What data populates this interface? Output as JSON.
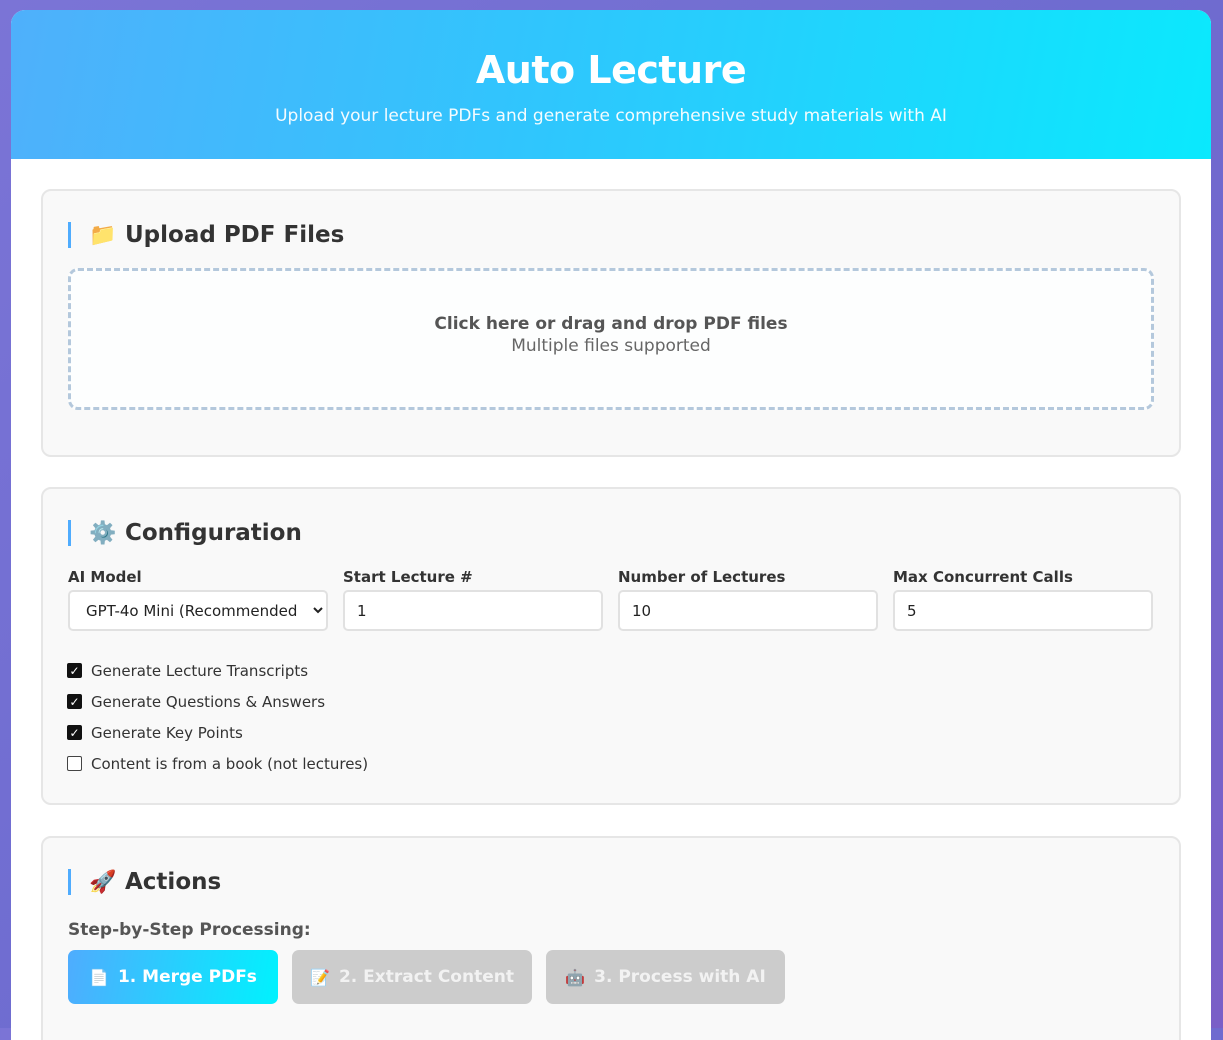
{
  "header": {
    "title": "Auto Lecture",
    "subtitle": "Upload your lecture PDFs and generate comprehensive study materials with AI"
  },
  "upload": {
    "title": "Upload PDF Files",
    "icon": "folder-icon",
    "drop_primary": "Click here or drag and drop PDF files",
    "drop_secondary": "Multiple files supported"
  },
  "config": {
    "title": "Configuration",
    "icon": "gear-icon",
    "ai_model_label": "AI Model",
    "ai_model_value": "GPT-4o Mini (Recommended)",
    "start_lecture_label": "Start Lecture #",
    "start_lecture_value": "1",
    "num_lectures_label": "Number of Lectures",
    "num_lectures_value": "10",
    "max_calls_label": "Max Concurrent Calls",
    "max_calls_value": "5",
    "checkboxes": [
      {
        "label": "Generate Lecture Transcripts",
        "checked": true
      },
      {
        "label": "Generate Questions & Answers",
        "checked": true
      },
      {
        "label": "Generate Key Points",
        "checked": true
      },
      {
        "label": "Content is from a book (not lectures)",
        "checked": false
      }
    ]
  },
  "actions": {
    "title": "Actions",
    "icon": "rocket-icon",
    "step_label": "Step-by-Step Processing:",
    "buttons": [
      {
        "label": "1. Merge PDFs",
        "icon": "document-icon",
        "enabled": true
      },
      {
        "label": "2. Extract Content",
        "icon": "memo-icon",
        "enabled": false
      },
      {
        "label": "3. Process with AI",
        "icon": "robot-icon",
        "enabled": false
      }
    ]
  },
  "colors": {
    "accent_start": "#4facfe",
    "accent_end": "#00f2fe",
    "disabled": "#cccccc"
  }
}
